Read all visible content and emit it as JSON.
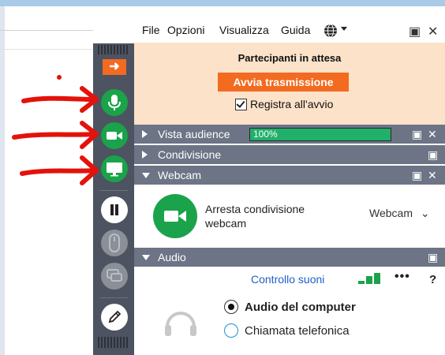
{
  "menu": {
    "file": "File",
    "options": "Opzioni",
    "view": "Visualizza",
    "help": "Guida"
  },
  "waiting": {
    "title": "Partecipanti in attesa",
    "start_button": "Avvia trasmissione",
    "record_label": "Registra all'avvio"
  },
  "sections": {
    "audience": {
      "label": "Vista audience",
      "zoom": "100%",
      "zoom_fraction": 1.0
    },
    "sharing": {
      "label": "Condivisione"
    },
    "webcam": {
      "label": "Webcam",
      "stop_text": "Arresta condivisione webcam",
      "dropdown": "Webcam"
    },
    "audio": {
      "label": "Audio",
      "sound_control": "Controllo suoni",
      "more": "•••",
      "help": "?",
      "options": [
        "Audio del computer",
        "Chiamata telefonica"
      ],
      "selected": "Audio del computer"
    }
  },
  "colors": {
    "accent": "#f26b21",
    "green": "#1aa34a",
    "section_bar": "#6c7485",
    "toolbar": "#4d5360",
    "annotation": "#e3120b"
  },
  "toolbar": {
    "collapse_icon": "arrow-right-icon",
    "buttons": [
      "mic-icon",
      "video-camera-icon",
      "screen-share-icon",
      "pause-icon",
      "mouse-icon",
      "chat-icon",
      "pen-icon"
    ]
  }
}
